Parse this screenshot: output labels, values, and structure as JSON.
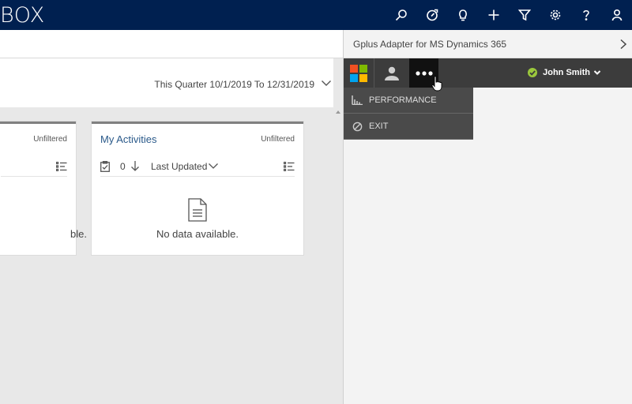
{
  "header": {
    "brand": "BOX",
    "icons": [
      "search-icon",
      "compass-icon",
      "lightbulb-icon",
      "plus-icon",
      "filter-icon",
      "gear-icon",
      "help-icon",
      "user-icon"
    ]
  },
  "dashboard": {
    "date_filter": "This Quarter 10/1/2019 To 12/31/2019",
    "cards": [
      {
        "title": "",
        "filter": "Unfiltered",
        "no_data": "ble."
      },
      {
        "title": "My Activities",
        "filter": "Unfiltered",
        "count": "0",
        "sort_label": "Last Updated",
        "no_data": "No data available."
      }
    ]
  },
  "panel": {
    "title": "Gplus Adapter for MS Dynamics 365",
    "user_name": "John Smith",
    "status_color": "#9bc83c",
    "menu": [
      {
        "label": "PERFORMANCE",
        "icon": "bar-chart-icon"
      },
      {
        "label": "EXIT",
        "icon": "block-icon"
      }
    ]
  },
  "colors": {
    "topbar": "#002050",
    "panel_dark": "#3c3c3c",
    "link": "#2b5a8a"
  }
}
